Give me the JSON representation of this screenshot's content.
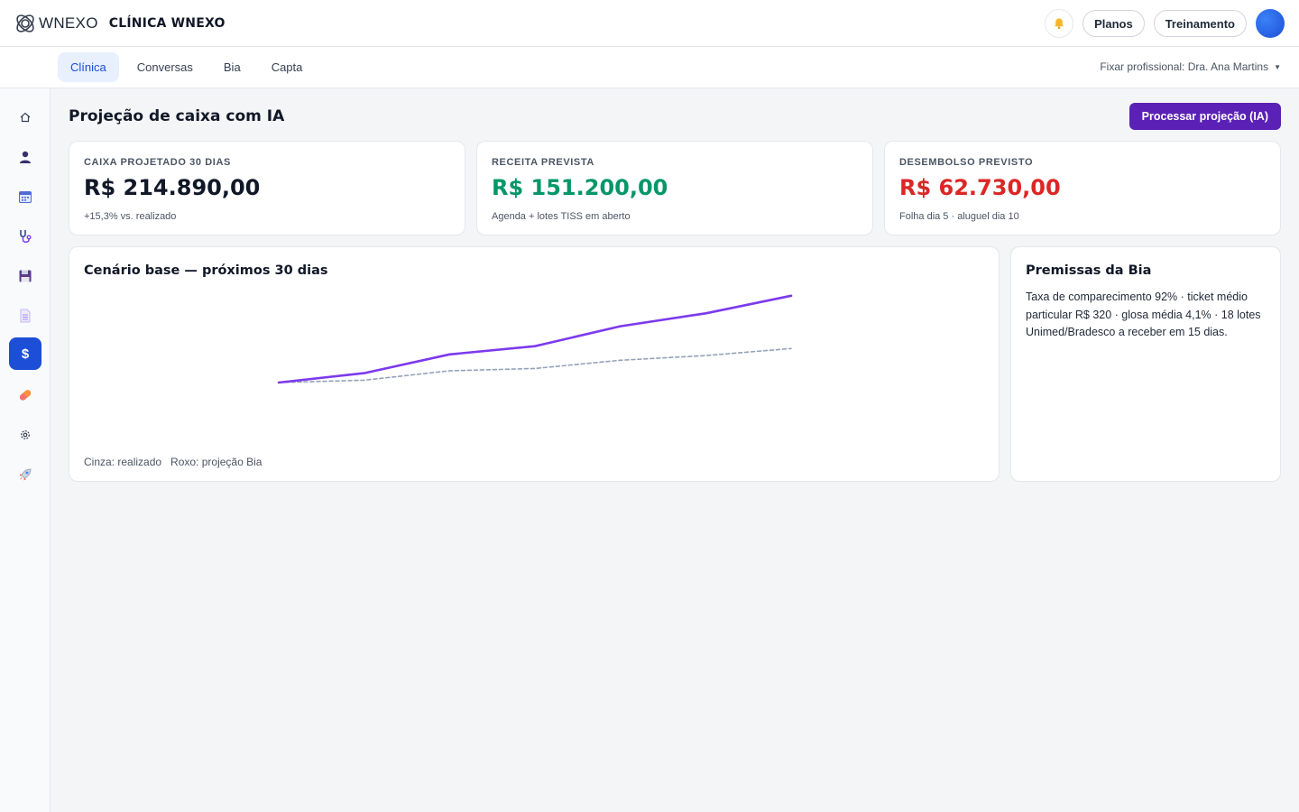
{
  "header": {
    "logo_text": "WNEXO",
    "clinic_name": "CLÍNICA WNEXO",
    "bell_icon": "bell-icon",
    "planos_label": "Planos",
    "treinamento_label": "Treinamento"
  },
  "subnav": {
    "tabs": [
      {
        "label": "Clínica",
        "active": true
      },
      {
        "label": "Conversas",
        "active": false
      },
      {
        "label": "Bia",
        "active": false
      },
      {
        "label": "Capta",
        "active": false
      }
    ],
    "fix_professional": "Fixar profissional: Dra. Ana Martins"
  },
  "sidebar": {
    "items": [
      {
        "icon": "home-icon",
        "active": false
      },
      {
        "icon": "user-icon",
        "active": false
      },
      {
        "icon": "calendar-icon",
        "active": false
      },
      {
        "icon": "stethoscope-icon",
        "active": false
      },
      {
        "icon": "floppy-disk-icon",
        "active": false
      },
      {
        "icon": "document-icon",
        "active": false
      },
      {
        "icon": "dollar-icon",
        "active": true,
        "glyph": "$"
      },
      {
        "icon": "pill-icon",
        "active": false
      },
      {
        "icon": "gear-icon",
        "active": false
      },
      {
        "icon": "rocket-icon",
        "active": false
      }
    ]
  },
  "main": {
    "title": "Projeção de caixa com IA",
    "process_button": "Processar projeção (IA)",
    "kpis": [
      {
        "label": "CAIXA PROJETADO 30 DIAS",
        "value": "R$ 214.890,00",
        "sub": "+15,3% vs. realizado",
        "color": "#111827"
      },
      {
        "label": "RECEITA PREVISTA",
        "value": "R$ 151.200,00",
        "sub": "Agenda + lotes TISS em aberto",
        "color": "#059669"
      },
      {
        "label": "DESEMBOLSO PREVISTO",
        "value": "R$ 62.730,00",
        "sub": "Folha dia 5 · aluguel dia 10",
        "color": "#dc2626"
      }
    ],
    "chart_card": {
      "title": "Cenário base — próximos 30 dias",
      "legend_gray": "Cinza: realizado",
      "legend_purple": "Roxo: projeção Bia"
    },
    "premissas": {
      "title": "Premissas da Bia",
      "text": "Taxa de comparecimento 92% · ticket médio particular R$ 320 · glosa média 4,1% · 18 lotes Unimed/Bradesco a receber em 15 dias."
    }
  },
  "chart_data": {
    "type": "line",
    "title": "Cenário base — próximos 30 dias",
    "x": [
      1,
      2,
      3,
      4,
      5,
      6,
      7
    ],
    "series": [
      {
        "name": "Roxo: projeção Bia",
        "color": "#7c3aed",
        "style": "solid",
        "values": [
          0,
          8,
          24,
          31,
          48,
          59,
          74
        ]
      },
      {
        "name": "Cinza: realizado",
        "color": "#94a3b8",
        "style": "dashed",
        "values": [
          0,
          2,
          10,
          12,
          19,
          23,
          29
        ]
      }
    ],
    "ylim": [
      0,
      100
    ],
    "grid": false,
    "xlabel": "",
    "ylabel": ""
  },
  "colors": {
    "accent": "#1d4ed8",
    "process_button": "#5b21b6",
    "tab_active_bg": "#e8effd"
  }
}
